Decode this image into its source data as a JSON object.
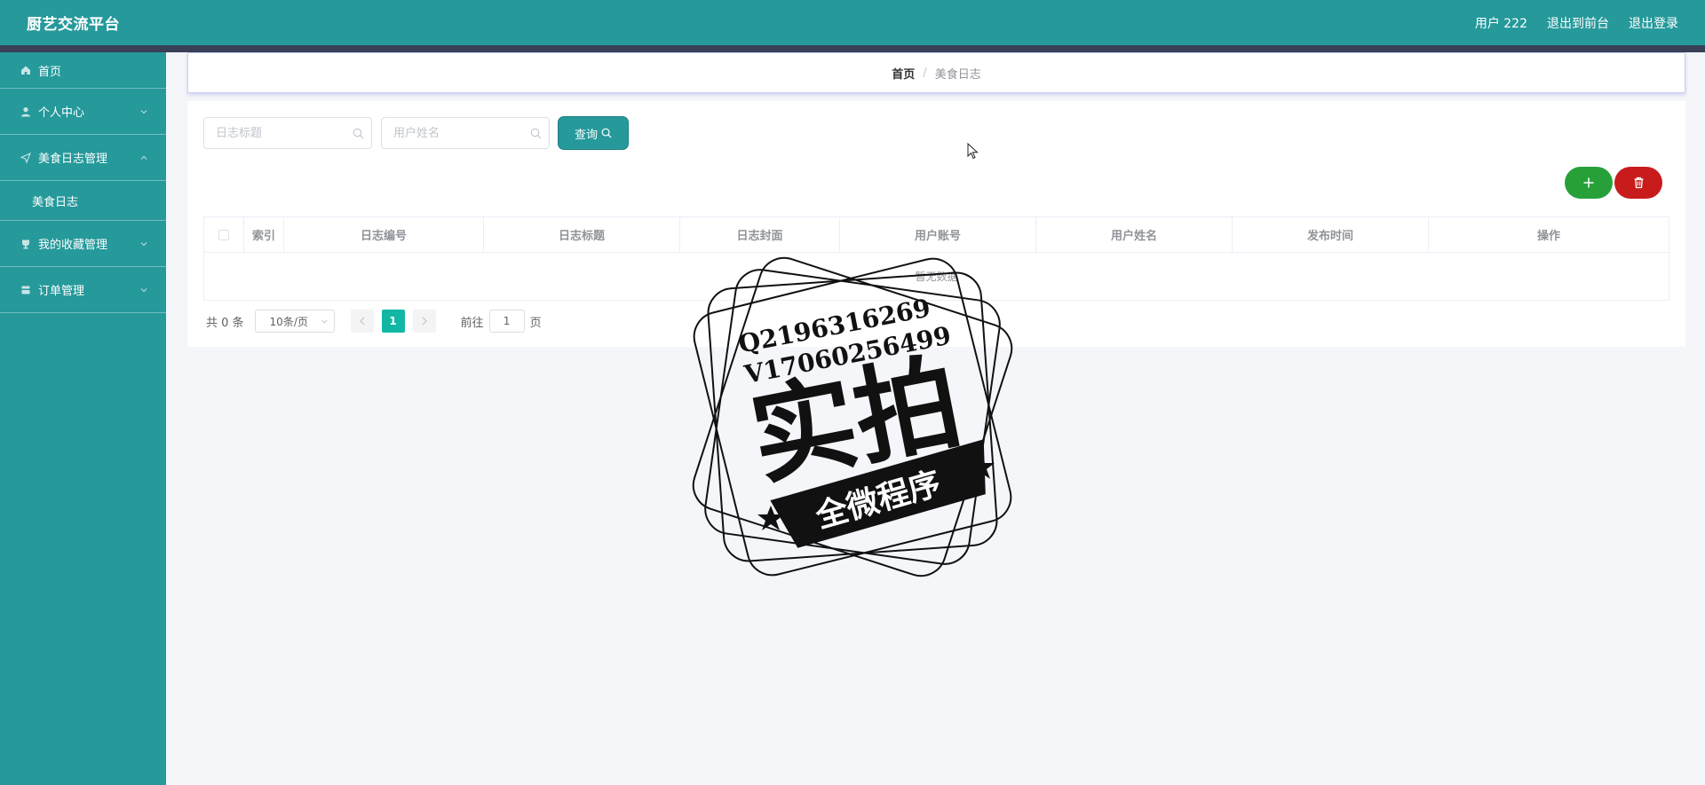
{
  "header": {
    "brand": "厨艺交流平台",
    "user": "用户 222",
    "to_front": "退出到前台",
    "logout": "退出登录"
  },
  "sidebar": {
    "items": [
      {
        "label": "首页",
        "icon": "home-icon"
      },
      {
        "label": "个人中心",
        "icon": "user-icon"
      },
      {
        "label": "美食日志管理",
        "icon": "send-icon"
      },
      {
        "label": "美食日志"
      },
      {
        "label": "我的收藏管理",
        "icon": "trophy-icon"
      },
      {
        "label": "订单管理",
        "icon": "order-icon"
      }
    ]
  },
  "breadcrumb": {
    "home": "首页",
    "sep": "/",
    "current": "美食日志"
  },
  "search": {
    "title_placeholder": "日志标题",
    "name_placeholder": "用户姓名",
    "query_label": "查询"
  },
  "actions": {
    "add": "+"
  },
  "table": {
    "columns": [
      "索引",
      "日志编号",
      "日志标题",
      "日志封面",
      "用户账号",
      "用户姓名",
      "发布时间",
      "操作"
    ],
    "empty": "暂无数据"
  },
  "pager": {
    "total": "共 0 条",
    "page_size": "10条/页",
    "current_page": "1",
    "goto_label": "前往",
    "goto_value": "1",
    "page_unit": "页"
  },
  "watermark": {
    "line1": "Q2196316269",
    "line2": "V17060256499",
    "big": "实拍",
    "banner": "全微程序"
  },
  "colors": {
    "primary": "#26999b",
    "add": "#27a03a",
    "delete": "#c81b1b",
    "page_active": "#12b7a4"
  }
}
